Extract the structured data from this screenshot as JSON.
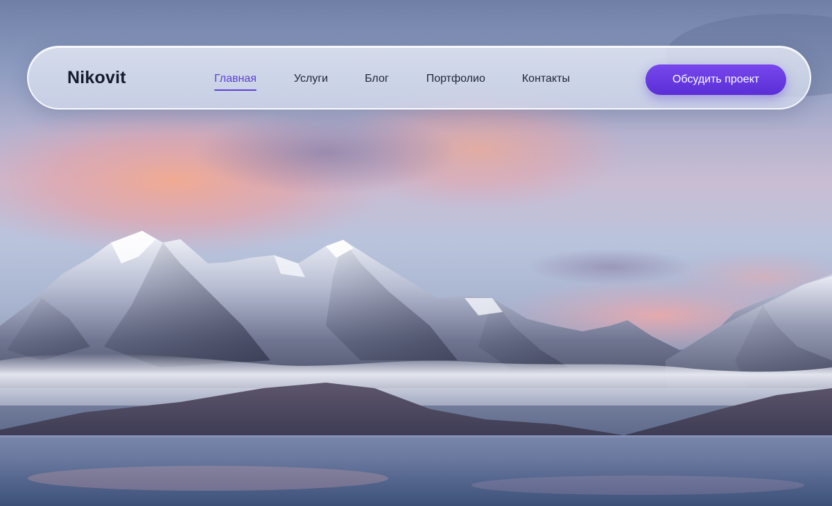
{
  "header": {
    "logo": "Nikovit",
    "nav": [
      {
        "label": "Главная",
        "active": true
      },
      {
        "label": "Услуги",
        "active": false
      },
      {
        "label": "Блог",
        "active": false
      },
      {
        "label": "Портфолио",
        "active": false
      },
      {
        "label": "Контакты",
        "active": false
      }
    ],
    "cta_label": "Обсудить проект"
  },
  "colors": {
    "accent": "#5b3fd4",
    "cta": "#6a3be2",
    "text": "#151a2c"
  },
  "hero": {
    "image": "mountain-lake-sunrise"
  }
}
